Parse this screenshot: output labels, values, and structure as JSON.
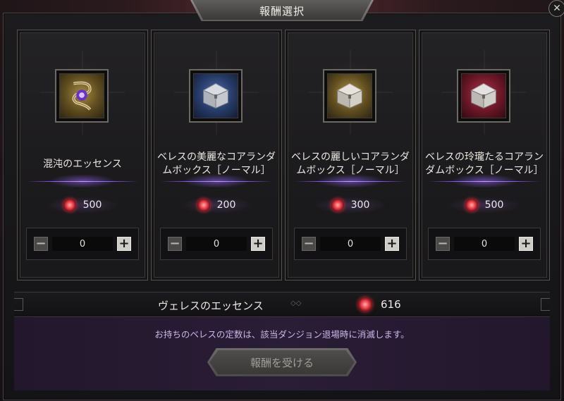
{
  "window": {
    "title": "報酬選択",
    "close_glyph": "✕"
  },
  "cards": [
    {
      "name": "混沌のエッセンス",
      "price": "500",
      "quantity": "0",
      "icon": "scroll-orb-icon",
      "icon_bg": "gold"
    },
    {
      "name": "ベレスの美麗なコアランダムボックス［ノーマル］",
      "price": "200",
      "quantity": "0",
      "icon": "chest-icon",
      "icon_bg": "blue"
    },
    {
      "name": "ベレスの麗しいコアランダムボックス［ノーマル］",
      "price": "300",
      "quantity": "0",
      "icon": "chest-icon",
      "icon_bg": "gold"
    },
    {
      "name": "ベレスの玲瓏たるコアランダムボックス［ノーマル］",
      "price": "500",
      "quantity": "0",
      "icon": "chest-icon",
      "icon_bg": "red"
    }
  ],
  "stepper": {
    "minus_glyph": "−",
    "plus_glyph": "+"
  },
  "essence": {
    "label": "ヴェレスのエッセンス",
    "value": "616"
  },
  "notice": "お持ちのベレスの定数は、該当ダンジョン退場時に消滅します。",
  "claim_button": "報酬を受ける",
  "colors": {
    "accent_purple": "#8a5cff",
    "gem_red": "#e0303a",
    "notice_text": "#c9b7e6"
  }
}
